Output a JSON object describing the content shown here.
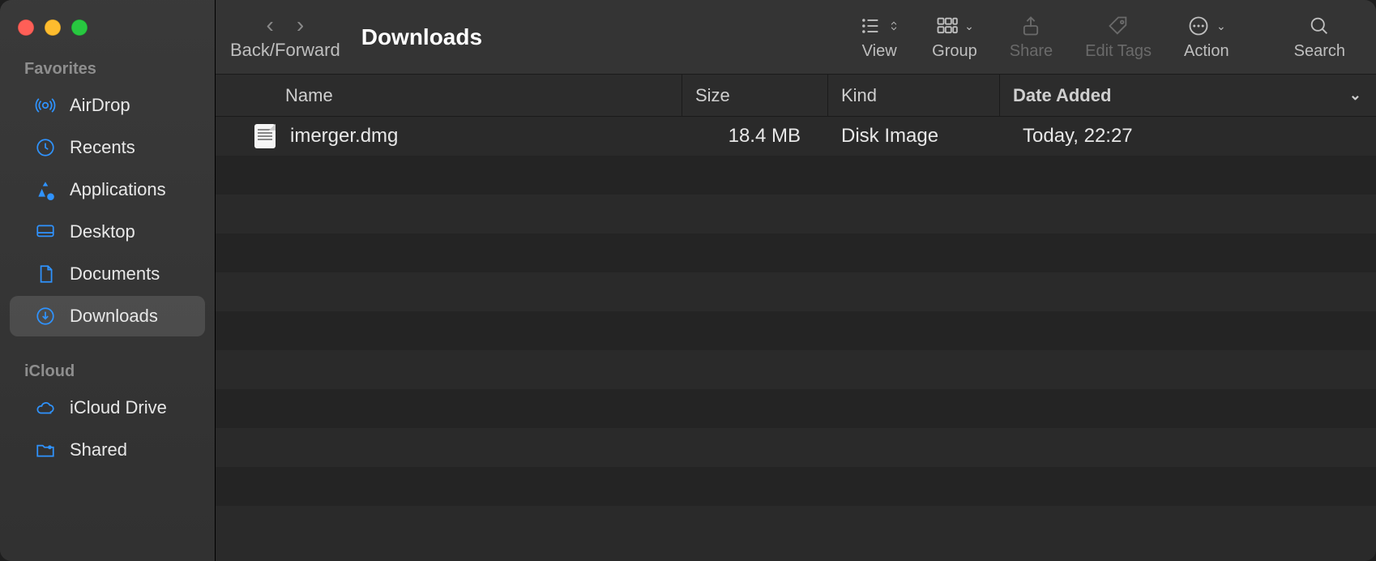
{
  "window": {
    "title": "Downloads"
  },
  "toolbar": {
    "nav_label": "Back/Forward",
    "view_label": "View",
    "group_label": "Group",
    "share_label": "Share",
    "tags_label": "Edit Tags",
    "action_label": "Action",
    "search_label": "Search"
  },
  "sidebar": {
    "sections": [
      {
        "label": "Favorites",
        "items": [
          {
            "id": "airdrop",
            "label": "AirDrop",
            "active": false
          },
          {
            "id": "recents",
            "label": "Recents",
            "active": false
          },
          {
            "id": "applications",
            "label": "Applications",
            "active": false
          },
          {
            "id": "desktop",
            "label": "Desktop",
            "active": false
          },
          {
            "id": "documents",
            "label": "Documents",
            "active": false
          },
          {
            "id": "downloads",
            "label": "Downloads",
            "active": true
          }
        ]
      },
      {
        "label": "iCloud",
        "items": [
          {
            "id": "icloud-drive",
            "label": "iCloud Drive",
            "active": false
          },
          {
            "id": "shared",
            "label": "Shared",
            "active": false
          }
        ]
      }
    ]
  },
  "columns": {
    "name": "Name",
    "size": "Size",
    "kind": "Kind",
    "date_added": "Date Added",
    "sort_column": "date_added"
  },
  "files": [
    {
      "name": "imerger.dmg",
      "size": "18.4 MB",
      "kind": "Disk Image",
      "date_added": "Today, 22:27"
    }
  ]
}
